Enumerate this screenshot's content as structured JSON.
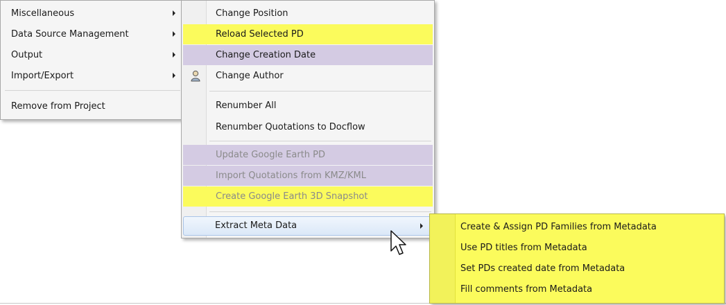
{
  "menu_main": {
    "items": [
      {
        "label": "Miscellaneous"
      },
      {
        "label": "Data Source Management"
      },
      {
        "label": "Output"
      },
      {
        "label": "Import/Export"
      },
      {
        "label": "Remove from Project"
      }
    ]
  },
  "menu_misc": {
    "items": [
      {
        "label": "Change Position"
      },
      {
        "label": "Reload Selected PD"
      },
      {
        "label": "Change Creation Date"
      },
      {
        "label": "Change Author"
      },
      {
        "label": "Renumber All"
      },
      {
        "label": "Renumber Quotations to Docflow"
      },
      {
        "label": "Update Google Earth PD"
      },
      {
        "label": "Import Quotations from KMZ/KML"
      },
      {
        "label": "Create Google Earth 3D Snapshot"
      },
      {
        "label": "Extract Meta Data"
      }
    ],
    "author_icon": "user-icon"
  },
  "menu_meta": {
    "items": [
      {
        "label": "Create & Assign PD Families from Metadata"
      },
      {
        "label": "Use PD titles from Metadata"
      },
      {
        "label": "Set PDs created date from Metadata"
      },
      {
        "label": "Fill comments from Metadata"
      }
    ]
  },
  "colors": {
    "highlight_yellow": "#fbfb5c",
    "highlight_purple": "#d4cbe3",
    "menu_background": "#f5f5f5"
  }
}
